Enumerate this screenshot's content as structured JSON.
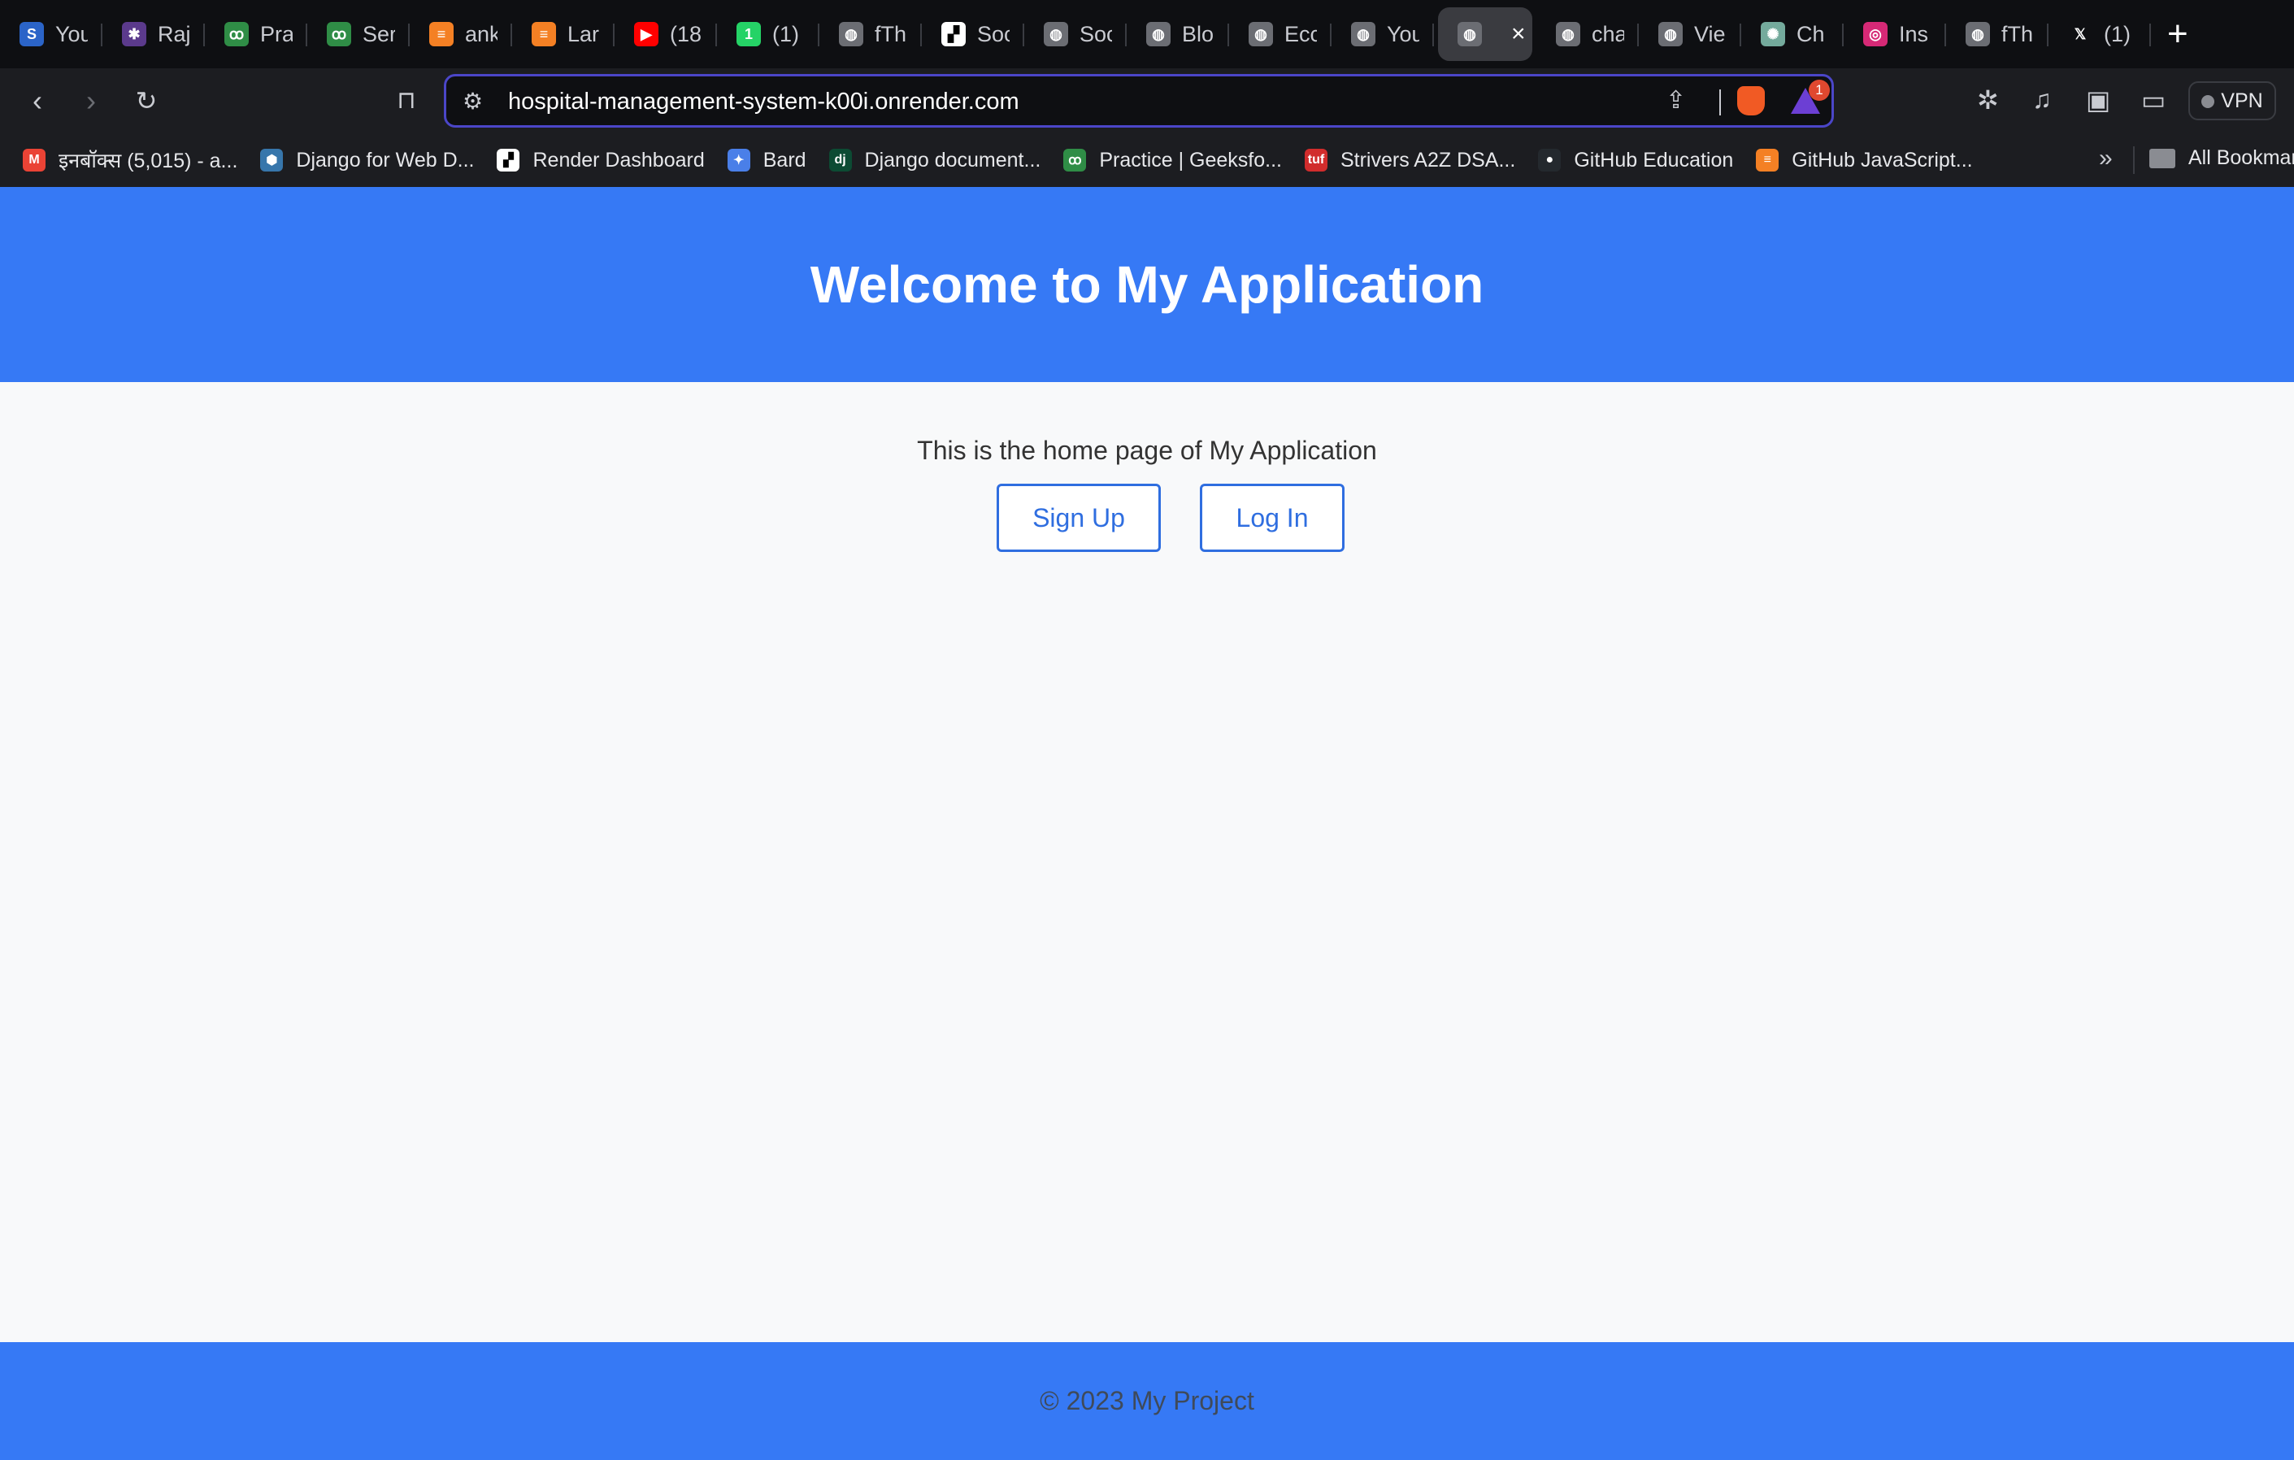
{
  "browser": {
    "tabs": [
      {
        "icon": "shortcut-s-icon",
        "title": "You",
        "fav_color": "#2b64c8",
        "fav_char": "S"
      },
      {
        "icon": "spider-icon",
        "title": "Raj",
        "fav_color": "#5b3a8c",
        "fav_char": "✱"
      },
      {
        "icon": "geeksforgeeks-icon",
        "title": "Pra",
        "fav_color": "#2f8d46",
        "fav_char": "ꝏ"
      },
      {
        "icon": "geeksforgeeks-icon",
        "title": "Ser",
        "fav_color": "#2f8d46",
        "fav_char": "ꝏ"
      },
      {
        "icon": "stackoverflow-icon",
        "title": "ank",
        "fav_color": "#f48024",
        "fav_char": "≡"
      },
      {
        "icon": "stackoverflow-icon",
        "title": "Lar",
        "fav_color": "#f48024",
        "fav_char": "≡"
      },
      {
        "icon": "youtube-icon",
        "title": "(18",
        "fav_color": "#ff0000",
        "fav_char": "▶"
      },
      {
        "icon": "whatsapp-icon",
        "title": "(1)",
        "fav_color": "#25d366",
        "fav_char": "1"
      },
      {
        "icon": "globe-icon",
        "title": "fTh",
        "fav_color": "#6b6d73",
        "fav_char": "◍"
      },
      {
        "icon": "render-icon",
        "title": "Soc",
        "fav_color": "#ffffff",
        "fav_char": "▞"
      },
      {
        "icon": "globe-icon",
        "title": "Soc",
        "fav_color": "#6b6d73",
        "fav_char": "◍"
      },
      {
        "icon": "globe-icon",
        "title": "Blo",
        "fav_color": "#6b6d73",
        "fav_char": "◍"
      },
      {
        "icon": "globe-icon",
        "title": "Ecc",
        "fav_color": "#6b6d73",
        "fav_char": "◍"
      },
      {
        "icon": "globe-icon",
        "title": "You",
        "fav_color": "#6b6d73",
        "fav_char": "◍"
      },
      {
        "icon": "globe-icon",
        "title": "",
        "fav_color": "#6b6d73",
        "fav_char": "◍",
        "active": true
      },
      {
        "icon": "globe-icon",
        "title": "cha",
        "fav_color": "#6b6d73",
        "fav_char": "◍"
      },
      {
        "icon": "globe-icon",
        "title": "Vie",
        "fav_color": "#6b6d73",
        "fav_char": "◍"
      },
      {
        "icon": "chatgpt-icon",
        "title": "Ch",
        "fav_color": "#74aa9c",
        "fav_char": "✺"
      },
      {
        "icon": "instagram-icon",
        "title": "Ins",
        "fav_color": "#d62976",
        "fav_char": "◎"
      },
      {
        "icon": "globe-icon",
        "title": "fTh",
        "fav_color": "#6b6d73",
        "fav_char": "◍"
      },
      {
        "icon": "x-icon",
        "title": "(1)",
        "fav_color": "#0e0f12",
        "fav_char": "𝕏"
      }
    ],
    "new_tab_label": "+",
    "close_tab_label": "×",
    "url": "hospital-management-system-k00i.onrender.com",
    "rewards_badge": "1",
    "vpn_label": "VPN",
    "bookmarks": [
      {
        "icon": "gmail-icon",
        "label": "इनबॉक्स (5,015) - a...",
        "color": "#ea4335",
        "char": "M"
      },
      {
        "icon": "python-icon",
        "label": "Django for Web D...",
        "color": "#3776ab",
        "char": "⬢"
      },
      {
        "icon": "render-icon",
        "label": "Render Dashboard",
        "color": "#ffffff",
        "char": "▞"
      },
      {
        "icon": "bard-icon",
        "label": "Bard",
        "color": "#4a7fe8",
        "char": "✦"
      },
      {
        "icon": "django-icon",
        "label": "Django document...",
        "color": "#0c4b33",
        "char": "dj"
      },
      {
        "icon": "geeksforgeeks-icon",
        "label": "Practice | Geeksfo...",
        "color": "#2f8d46",
        "char": "ꝏ"
      },
      {
        "icon": "tuf-icon",
        "label": "Strivers A2Z DSA...",
        "color": "#d12c2c",
        "char": "tuf"
      },
      {
        "icon": "github-icon",
        "label": "GitHub Education",
        "color": "#24292e",
        "char": "●"
      },
      {
        "icon": "stackoverflow-icon",
        "label": "GitHub JavaScript...",
        "color": "#f48024",
        "char": "≡"
      }
    ],
    "bookmarks_more": "»",
    "all_bookmarks": "All Bookmarks"
  },
  "page": {
    "header_title": "Welcome to My Application",
    "intro": "This is the home page of My Application",
    "signup_label": "Sign Up",
    "login_label": "Log In",
    "footer_text": "© 2023 My Project",
    "accent_color": "#3679f5"
  }
}
